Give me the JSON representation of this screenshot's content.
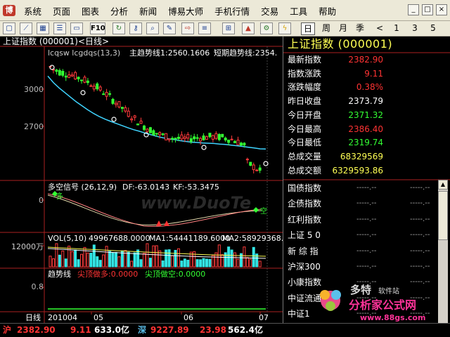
{
  "menu": [
    "系统",
    "页面",
    "图表",
    "分析",
    "新闻",
    "博易大师",
    "手机行情",
    "交易",
    "工具",
    "帮助"
  ],
  "toolbar": {
    "icons": [
      "blank-page-icon",
      "line-chart-icon",
      "table-icon",
      "news-icon",
      "f10-icon",
      "refresh-icon",
      "key-icon",
      "magnifier-icon",
      "pen-icon",
      "exit-icon",
      "alarm-icon",
      "bell-icon",
      "settings-icon",
      "lightning-icon"
    ],
    "periods": [
      "日",
      "周",
      "月",
      "季",
      "<",
      "1",
      "3",
      "5"
    ]
  },
  "chart": {
    "title": "上证指数 (000001)<日线>",
    "indicators": "lcqsw lcgdqs(13,3)",
    "trend_line": "主趋势线1:2560.1606",
    "short_trend": "短期趋势线:2354.",
    "y_labels": [
      "3000",
      "2700"
    ],
    "signal_title": "多空信号 (26,12,9)",
    "signal_df": "DF:-63.0143",
    "signal_kf": "KF:-53.3475",
    "signal_zero": "0",
    "signal_bull": "多",
    "signal_bear": "空",
    "vol_title": "VOL(5,10)",
    "vol_val": "49967688.0000",
    "ma1": "MA1:54441189.6000",
    "ma2": "MA2:58929368.0",
    "vol_y": "12000万",
    "trend_title": "趋势线",
    "trend_top_more": "尖顶做多:0.0000",
    "trend_top_short": "尖顶做空:0.0000",
    "trend_y": "0.8",
    "period": "日线",
    "x_labels": [
      "201004",
      "05",
      "06",
      "07"
    ],
    "watermark": "www.DuoTe"
  },
  "chart_data": {
    "type": "line",
    "series": [
      {
        "name": "主趋势线1",
        "values": [
          3110,
          3060,
          3020,
          2985,
          2950,
          2915,
          2885,
          2855,
          2828,
          2805,
          2785,
          2768,
          2752,
          2736,
          2720,
          2706,
          2694,
          2680,
          2668,
          2656,
          2646,
          2638,
          2632,
          2624,
          2618,
          2612,
          2610,
          2606,
          2604,
          2602,
          2598,
          2595,
          2590,
          2585,
          2580,
          2574,
          2568,
          2562,
          2560
        ]
      }
    ],
    "ylim": [
      2350,
      3250
    ]
  },
  "info": {
    "title": "上证指数 (000001)",
    "rows": [
      {
        "k": "最新指数",
        "v": "2382.90",
        "c": "#ff3333"
      },
      {
        "k": "指数涨跌",
        "v": "9.11",
        "c": "#ff3333"
      },
      {
        "k": "涨跌幅度",
        "v": "0.38%",
        "c": "#ff3333"
      },
      {
        "k": "昨日收盘",
        "v": "2373.79",
        "c": "#ffffff"
      },
      {
        "k": "今日开盘",
        "v": "2371.32",
        "c": "#33ff33"
      },
      {
        "k": "今日最高",
        "v": "2386.40",
        "c": "#ff3333"
      },
      {
        "k": "今日最低",
        "v": "2319.74",
        "c": "#33ff33"
      },
      {
        "k": "总成交量",
        "v": "68329569",
        "c": "#ffff54"
      },
      {
        "k": "总成交额",
        "v": "6329593.86",
        "c": "#ffff54"
      }
    ],
    "list": [
      "国债指数",
      "企债指数",
      "红利指数",
      "上证 5 0",
      "新 综 指",
      "沪深300",
      "小康指数",
      "中证流通",
      "中证1"
    ],
    "list_val": "-----.--"
  },
  "status": {
    "sh": "沪",
    "sh_index": "2382.90",
    "sh_chg": "9.11",
    "sh_amt": "633.0亿",
    "sz": "深",
    "sz_index": "9227.89",
    "sz_chg": "23.98",
    "sz_amt": "562.4亿"
  },
  "brand": {
    "logo": "多特",
    "sub": "软件站",
    "site": "分析家公式网",
    "url": "www.88gs.com"
  }
}
